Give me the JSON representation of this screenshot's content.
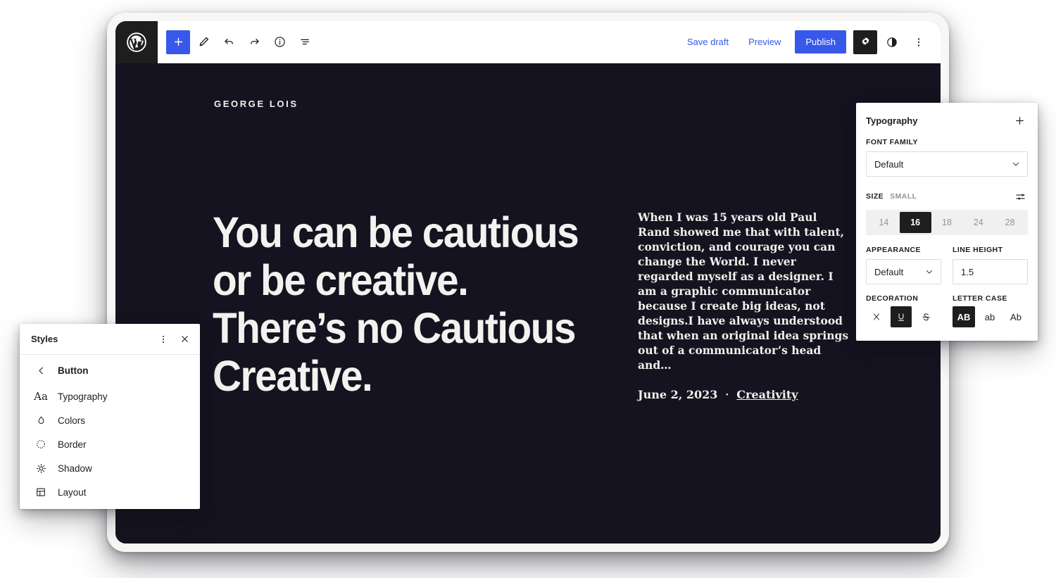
{
  "editor": {
    "logo_icon": "wordpress-logo-icon",
    "toolbar_left": [
      {
        "name": "add-block-button",
        "icon": "plus-icon",
        "label": "Add block"
      },
      {
        "name": "edit-tool-button",
        "icon": "pencil-icon",
        "label": "Tools"
      },
      {
        "name": "undo-button",
        "icon": "undo-icon",
        "label": "Undo"
      },
      {
        "name": "redo-button",
        "icon": "redo-icon",
        "label": "Redo"
      },
      {
        "name": "details-button",
        "icon": "info-icon",
        "label": "Details"
      },
      {
        "name": "list-view-button",
        "icon": "list-view-icon",
        "label": "List View"
      }
    ],
    "save_draft_label": "Save draft",
    "preview_label": "Preview",
    "publish_label": "Publish",
    "settings_icon": "gear-icon",
    "styles_icon": "contrast-half-circle-icon",
    "options_icon": "kebab-menu-icon",
    "accent_color": "#3858e9",
    "dark_tile_color": "#1e1e1e"
  },
  "post": {
    "eyebrow": "GEORGE LOIS",
    "headline": "You can be cautious or be creative. There’s no Cautious Creative.",
    "excerpt": "When I was 15 years old Paul Rand showed me that with talent, conviction, and courage you can change the World. I never regarded myself as a designer. I am a graphic communicator because I create big ideas, not designs.I have always understood that when an original idea springs out of a communicator’s head and…",
    "date": "June 2, 2023",
    "separator": "·",
    "category": "Creativity",
    "canvas_background": "#15131f",
    "canvas_text_color": "#f3f2ef"
  },
  "styles_panel": {
    "title": "Styles",
    "more_icon": "kebab-menu-icon",
    "close_icon": "close-icon",
    "back_icon": "chevron-left-icon",
    "back_label": "Button",
    "items": [
      {
        "label": "Typography",
        "icon": "aa-typography-icon"
      },
      {
        "label": "Colors",
        "icon": "droplet-icon"
      },
      {
        "label": "Border",
        "icon": "dotted-circle-icon"
      },
      {
        "label": "Shadow",
        "icon": "sun-shadow-icon"
      },
      {
        "label": "Layout",
        "icon": "layout-grid-icon"
      }
    ]
  },
  "typography_panel": {
    "title": "Typography",
    "add_icon": "plus-icon",
    "font_family": {
      "label": "FONT FAMILY",
      "value": "Default",
      "chevron_icon": "chevron-down-icon"
    },
    "size": {
      "label": "SIZE",
      "value_label": "SMALL",
      "settings_icon": "sliders-icon",
      "options": [
        "14",
        "16",
        "18",
        "24",
        "28"
      ],
      "selected": "16"
    },
    "appearance": {
      "label": "APPEARANCE",
      "value": "Default",
      "chevron_icon": "chevron-down-icon"
    },
    "line_height": {
      "label": "LINE HEIGHT",
      "value": "1.5"
    },
    "decoration": {
      "label": "DECORATION",
      "options": [
        {
          "glyph": "X",
          "name": "decoration-none",
          "active": false
        },
        {
          "glyph": "U",
          "name": "decoration-underline",
          "active": true
        },
        {
          "glyph": "S",
          "name": "decoration-strikethrough",
          "active": false
        }
      ]
    },
    "letter_case": {
      "label": "LETTER CASE",
      "options": [
        {
          "glyph": "AB",
          "name": "letter-case-uppercase",
          "active": true
        },
        {
          "glyph": "ab",
          "name": "letter-case-lowercase",
          "active": false
        },
        {
          "glyph": "Ab",
          "name": "letter-case-capitalize",
          "active": false
        }
      ]
    }
  }
}
